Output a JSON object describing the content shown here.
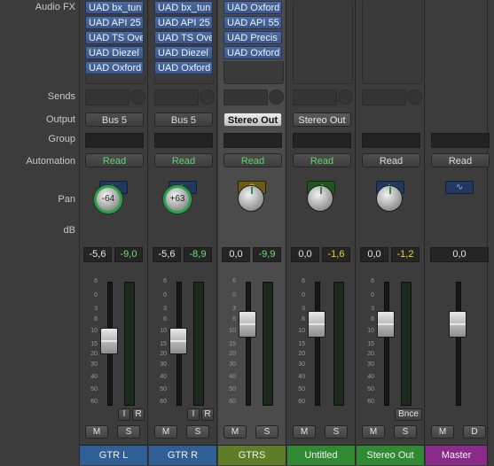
{
  "labels": {
    "audio_fx": "Audio FX",
    "sends": "Sends",
    "output": "Output",
    "group": "Group",
    "automation": "Automation",
    "pan": "Pan",
    "db": "dB"
  },
  "scale": [
    "6",
    "0",
    "3",
    "6",
    "10",
    "15",
    "20",
    "30",
    "40",
    "50",
    "60"
  ],
  "strips": [
    {
      "name": "GTR L",
      "name_color": "#2f5f95",
      "fx": [
        "UAD bx_tun",
        "UAD API 25",
        "UAD TS Ove",
        "UAD Diezel",
        "UAD Oxford"
      ],
      "output": "Bus 5",
      "automation": "Read",
      "insert_icon": "waveform-icon",
      "pan": "-64",
      "db_left": "-5,6",
      "db_right": "-9,0",
      "fader_level": 0.45,
      "input": "I",
      "record": "R",
      "mute": "M",
      "solo": "S"
    },
    {
      "name": "GTR R",
      "name_color": "#2f5f95",
      "fx": [
        "UAD bx_tun",
        "UAD API 25",
        "UAD TS Ove",
        "UAD Diezel",
        "UAD Oxford"
      ],
      "output": "Bus 5",
      "automation": "Read",
      "insert_icon": "waveform-icon",
      "pan": "+63",
      "db_left": "-5,6",
      "db_right": "-8,9",
      "fader_level": 0.45,
      "input": "I",
      "record": "R",
      "mute": "M",
      "solo": "S"
    },
    {
      "name": "GTRS",
      "name_color": "#5f7d26",
      "fx": [
        "UAD Oxford",
        "UAD API 55",
        "UAD Precis",
        "UAD Oxford"
      ],
      "output": "Stereo Out",
      "automation": "Read",
      "insert_icon": "clock-icon",
      "pan": "",
      "db_left": "0,0",
      "db_right": "-9,9",
      "fader_level": 0.62,
      "mute": "M",
      "solo": "S"
    },
    {
      "name": "Untitled",
      "name_color": "#2f8a33",
      "fx": [],
      "output": "Stereo Out",
      "automation": "Read",
      "insert_icon": "music-note-icon",
      "pan": "",
      "db_left": "0,0",
      "db_right": "-1,6",
      "fader_level": 0.62,
      "mute": "M",
      "solo": "S"
    },
    {
      "name": "Stereo Out",
      "name_color": "#2f8a33",
      "fx": [],
      "output": "",
      "automation": "Read",
      "insert_icon": "waveform-icon",
      "pan": "",
      "db_left": "0,0",
      "db_right": "-1,2",
      "fader_level": 0.62,
      "bounce": "Bnce",
      "mute": "M",
      "solo": "S"
    },
    {
      "name": "Master",
      "name_color": "#8a2a8a",
      "fx": [],
      "output": "",
      "automation": "Read",
      "insert_icon": "waveform-icon",
      "pan": "",
      "db_left": "0,0",
      "db_right": "",
      "fader_level": 0.62,
      "mute": "M",
      "solo": "D"
    }
  ]
}
